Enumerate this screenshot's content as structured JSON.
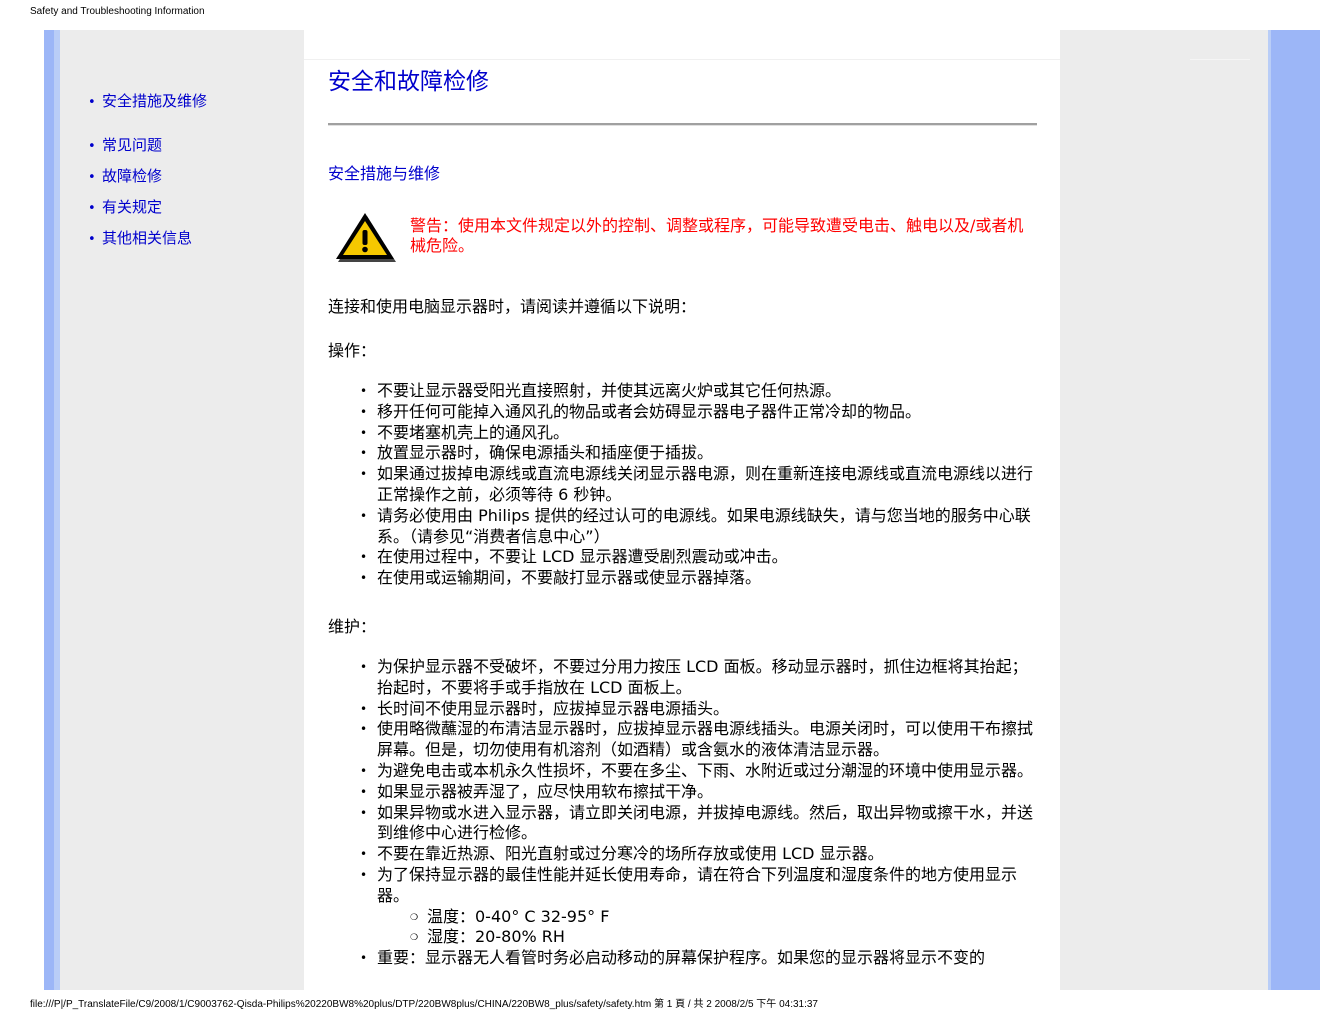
{
  "print_header": "Safety and Troubleshooting Information",
  "print_footer": "file:///P|/P_TranslateFile/C9/2008/1/C9003762-Qisda-Philips%20220BW8%20plus/DTP/220BW8plus/CHINA/220BW8_plus/safety/safety.htm 第 1 頁 / 共 2 2008/2/5 下午 04:31:37",
  "colors": {
    "link": "#0000cc",
    "warning": "#ff0000",
    "sidebar_bg": "#ececec",
    "accent_blue": "#9cb6f7"
  },
  "sidebar": {
    "items": [
      {
        "label": "安全措施及维修"
      },
      {
        "label": "常见问题"
      },
      {
        "label": "故障检修"
      },
      {
        "label": "有关规定"
      },
      {
        "label": "其他相关信息"
      }
    ]
  },
  "main": {
    "page_title": "安全和故障检修",
    "section_title": "安全措施与维修",
    "warning_icon": "warning-triangle-icon",
    "warning_text": "警告：使用本文件规定以外的控制、调整或程序，可能导致遭受电击、触电以及/或者机械危险。",
    "intro": "连接和使用电脑显示器时，请阅读并遵循以下说明：",
    "operation_heading": "操作：",
    "operation_items": [
      "不要让显示器受阳光直接照射，并使其远离火炉或其它任何热源。",
      "移开任何可能掉入通风孔的物品或者会妨碍显示器电子器件正常冷却的物品。",
      "不要堵塞机壳上的通风孔。",
      "放置显示器时，确保电源插头和插座便于插拔。",
      "如果通过拔掉电源线或直流电源线关闭显示器电源，则在重新连接电源线或直流电源线以进行正常操作之前，必须等待 6 秒钟。",
      "请务必使用由 Philips 提供的经过认可的电源线。如果电源线缺失，请与您当地的服务中心联系。（请参见“消费者信息中心”）",
      "在使用过程中，不要让 LCD 显示器遭受剧烈震动或冲击。",
      "在使用或运输期间，不要敲打显示器或使显示器掉落。"
    ],
    "maintenance_heading": "维护：",
    "maintenance_items": [
      "为保护显示器不受破坏，不要过分用力按压 LCD 面板。移动显示器时，抓住边框将其抬起；抬起时，不要将手或手指放在 LCD 面板上。",
      "长时间不使用显示器时，应拔掉显示器电源插头。",
      "使用略微蘸湿的布清洁显示器时，应拔掉显示器电源线插头。电源关闭时，可以使用干布擦拭屏幕。但是，切勿使用有机溶剂（如酒精）或含氨水的液体清洁显示器。",
      "为避免电击或本机永久性损坏，不要在多尘、下雨、水附近或过分潮湿的环境中使用显示器。",
      "如果显示器被弄湿了，应尽快用软布擦拭干净。",
      "如果异物或水进入显示器，请立即关闭电源，并拔掉电源线。然后，取出异物或擦干水，并送到维修中心进行检修。",
      "不要在靠近热源、阳光直射或过分寒冷的场所存放或使用 LCD 显示器。",
      "为了保持显示器的最佳性能并延长使用寿命，请在符合下列温度和湿度条件的地方使用显示器。"
    ],
    "conditions": [
      "温度：0-40° C 32-95° F",
      "湿度：20-80% RH"
    ],
    "important_item": "重要：显示器无人看管时务必启动移动的屏幕保护程序。如果您的显示器将显示不变的"
  }
}
